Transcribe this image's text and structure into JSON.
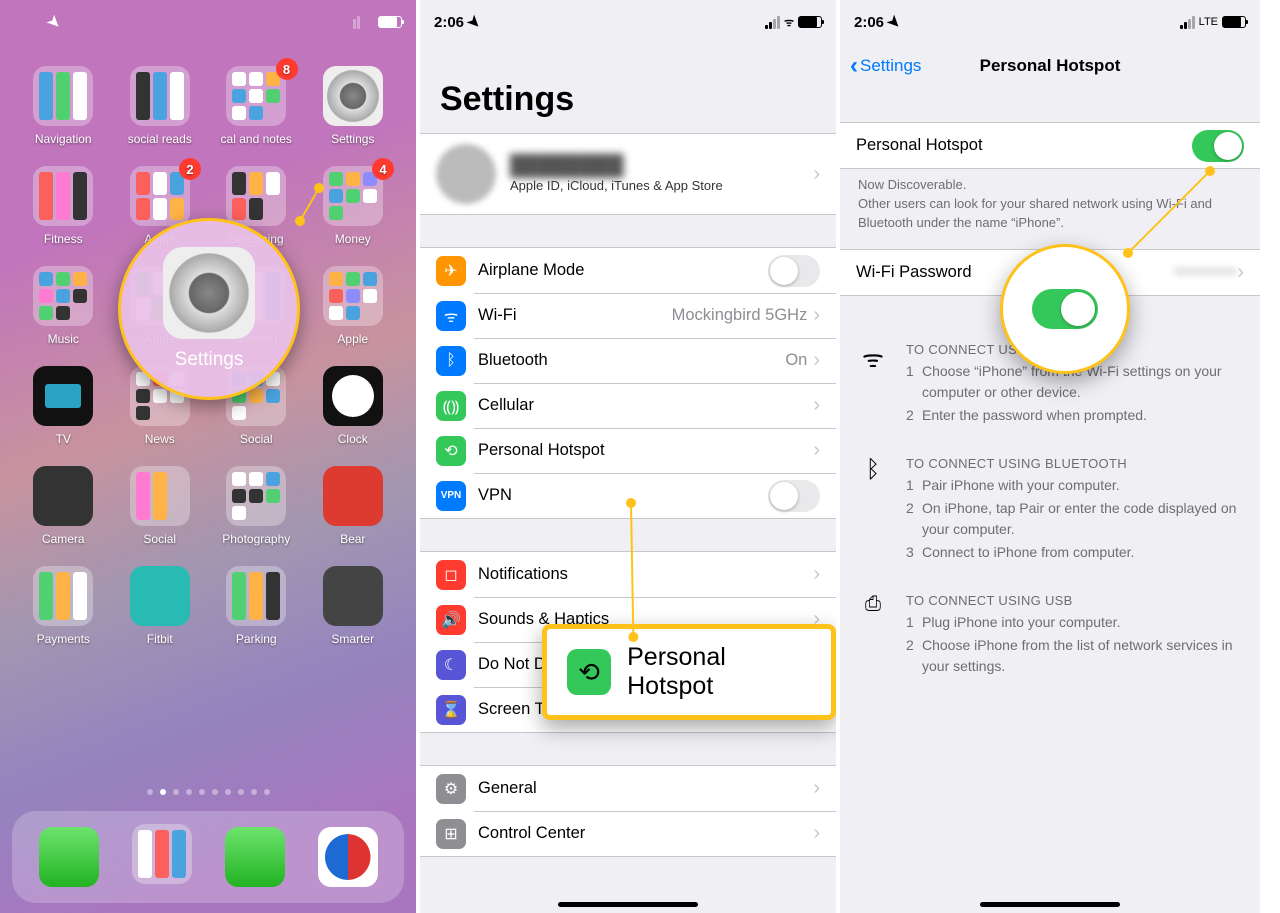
{
  "status": {
    "time": "2:06",
    "wifi_net": "Mockingbird 5GHz",
    "lte": "LTE"
  },
  "home": {
    "apps": [
      {
        "l": "Navigation"
      },
      {
        "l": "social reads"
      },
      {
        "l": "cal and notes",
        "b": "8"
      },
      {
        "l": "Settings"
      },
      {
        "l": "Fitness"
      },
      {
        "l": "Apple",
        "b": "2"
      },
      {
        "l": "Streaming"
      },
      {
        "l": "Money",
        "b": "4"
      },
      {
        "l": "Music"
      },
      {
        "l": "Apple"
      },
      {
        "l": "Gaming"
      },
      {
        "l": "Apple"
      },
      {
        "l": "TV"
      },
      {
        "l": "News"
      },
      {
        "l": "Social"
      },
      {
        "l": "Clock"
      },
      {
        "l": "Camera"
      },
      {
        "l": "Social"
      },
      {
        "l": "Photography"
      },
      {
        "l": "Bear"
      },
      {
        "l": "Payments"
      },
      {
        "l": "Fitbit"
      },
      {
        "l": "Parking"
      },
      {
        "l": "Smarter"
      }
    ],
    "callout": "Settings"
  },
  "settings": {
    "title": "Settings",
    "profile_sub": "Apple ID, iCloud, iTunes & App Store",
    "rows": {
      "airplane": "Airplane Mode",
      "wifi": "Wi-Fi",
      "wifi_val": "Mockingbird 5GHz",
      "bt": "Bluetooth",
      "bt_val": "On",
      "cell": "Cellular",
      "hotspot": "Personal Hotspot",
      "vpn": "VPN",
      "notif": "Notifications",
      "sounds": "Sounds & Haptics",
      "dnd": "Do Not Disturb",
      "st": "Screen Time",
      "gen": "General",
      "cc": "Control Center"
    },
    "callout": "Personal Hotspot"
  },
  "hotspot": {
    "back": "Settings",
    "title": "Personal Hotspot",
    "row": "Personal Hotspot",
    "discover": "Now Discoverable.",
    "disc_sub": "Other users can look for your shared network using Wi-Fi and Bluetooth under the name “iPhone”.",
    "wifipw_lbl": "Wi-Fi Password",
    "sec": {
      "wifi_h": "TO CONNECT USING WI-FI",
      "wifi1": "Choose “iPhone” from the Wi-Fi settings on your computer or other device.",
      "wifi2": "Enter the password when prompted.",
      "bt_h": "TO CONNECT USING BLUETOOTH",
      "bt1": "Pair iPhone with your computer.",
      "bt2": "On iPhone, tap Pair or enter the code displayed on your computer.",
      "bt3": "Connect to iPhone from computer.",
      "usb_h": "TO CONNECT USING USB",
      "usb1": "Plug iPhone into your computer.",
      "usb2": "Choose iPhone from the list of network services in your settings."
    }
  }
}
